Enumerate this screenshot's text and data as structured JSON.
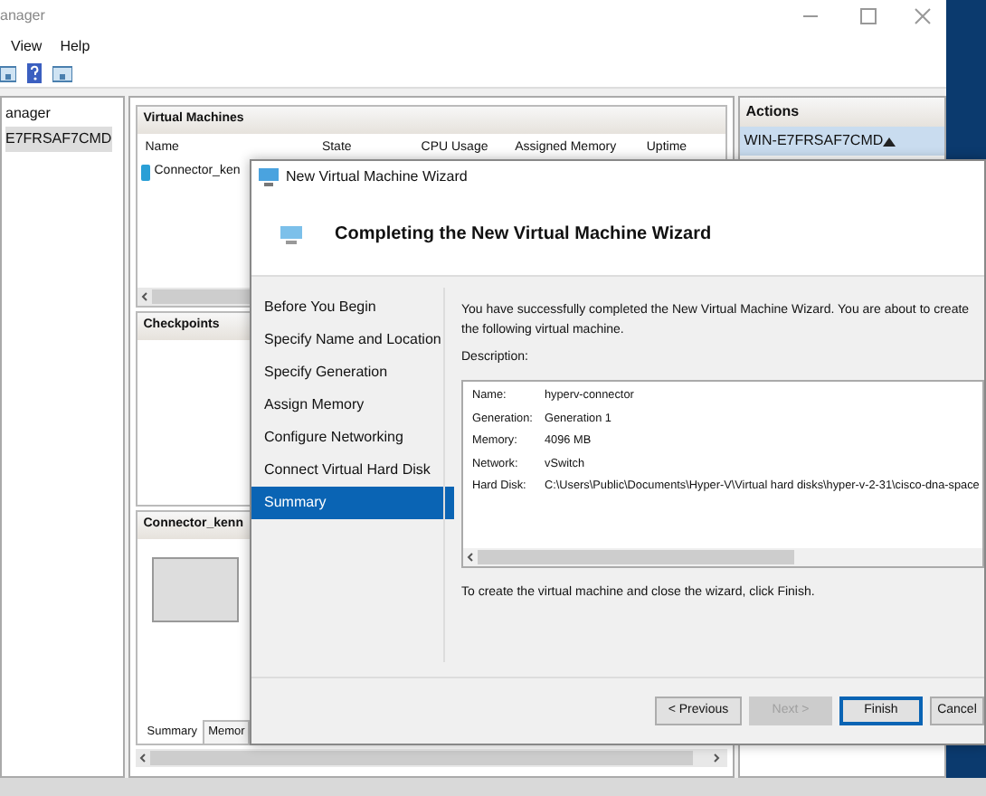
{
  "manager": {
    "title": "anager",
    "menu": [
      "View",
      "Help"
    ],
    "tree": [
      {
        "label": "anager",
        "selected": false
      },
      {
        "label": "E7FRSAF7CMD",
        "selected": true
      }
    ],
    "vm_panel": {
      "title": "Virtual Machines",
      "columns": [
        "Name",
        "State",
        "CPU Usage",
        "Assigned Memory",
        "Uptime"
      ],
      "rows": [
        {
          "name": "Connector_ken"
        }
      ]
    },
    "checkpoints": {
      "title": "Checkpoints"
    },
    "details": {
      "title": "Connector_kenn",
      "tabs": [
        {
          "label": "Summary",
          "selected": true
        },
        {
          "label": "Memor",
          "selected": false
        }
      ]
    },
    "actions": {
      "title": "Actions",
      "items": [
        {
          "label": "WIN-E7FRSAF7CMD",
          "selected": true
        }
      ]
    }
  },
  "wizard": {
    "title": "New Virtual Machine Wizard",
    "heading": "Completing the New Virtual Machine Wizard",
    "steps": [
      {
        "label": "Before You Begin",
        "selected": false
      },
      {
        "label": "Specify Name and Location",
        "selected": false
      },
      {
        "label": "Specify Generation",
        "selected": false
      },
      {
        "label": "Assign Memory",
        "selected": false
      },
      {
        "label": "Configure Networking",
        "selected": false
      },
      {
        "label": "Connect Virtual Hard Disk",
        "selected": false
      },
      {
        "label": "Summary",
        "selected": true
      }
    ],
    "intro": "You have successfully completed the New Virtual Machine Wizard. You are about to create the following virtual machine.",
    "description_label": "Description:",
    "description": [
      {
        "label": "Name:",
        "value": "hyperv-connector"
      },
      {
        "label": "Generation:",
        "value": "Generation 1"
      },
      {
        "label": "Memory:",
        "value": "4096 MB"
      },
      {
        "label": "Network:",
        "value": "vSwitch"
      },
      {
        "label": "Hard Disk:",
        "value": "C:\\Users\\Public\\Documents\\Hyper-V\\Virtual hard disks\\hyper-v-2-31\\cisco-dna-space"
      }
    ],
    "outro": "To create the virtual machine and close the wizard, click Finish.",
    "buttons": [
      {
        "label": "< Previous",
        "disabled": false,
        "default": false
      },
      {
        "label": "Next >",
        "disabled": true,
        "default": false
      },
      {
        "label": "Finish",
        "disabled": false,
        "default": true
      },
      {
        "label": "Cancel",
        "disabled": false,
        "default": false
      }
    ]
  }
}
